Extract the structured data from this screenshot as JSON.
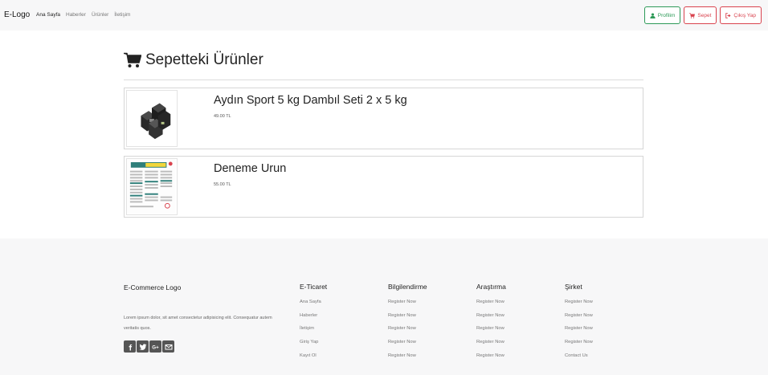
{
  "navbar": {
    "brand": "E-Logo",
    "links": [
      "Ana Sayfa",
      "Haberler",
      "Ürünler",
      "İletişim"
    ],
    "buttons": {
      "profile": "Profilim",
      "cart": "Sepet",
      "logout": "Çıkış Yap"
    }
  },
  "cart": {
    "title": "Sepetteki Ürünler",
    "items": [
      {
        "name": "Aydın Sport 5 kg Dambıl Seti 2 x 5 kg",
        "price": "49.00 TL",
        "image": "dumbbell-product-image"
      },
      {
        "name": "Deneme Urun",
        "price": "55.00 TL",
        "image": "javascript-cheatsheet-image"
      }
    ]
  },
  "footer": {
    "brand": "E-Commerce Logo",
    "about": "Lorem ipsum dolor, sit amet consectetur adipisicing elit. Consequatur autem veritatis quos.",
    "socials": [
      "facebook-icon",
      "twitter-icon",
      "google-plus-icon",
      "mail-icon"
    ],
    "columns": [
      {
        "title": "E-Ticaret",
        "links": [
          "Ana Sayfa",
          "Haberler",
          "İletişim",
          "Giriş Yap",
          "Kayıt Ol"
        ]
      },
      {
        "title": "Bilgilendirme",
        "links": [
          "Register Now",
          "Register Now",
          "Register Now",
          "Register Now",
          "Register Now"
        ]
      },
      {
        "title": "Araştırma",
        "links": [
          "Register Now",
          "Register Now",
          "Register Now",
          "Register Now",
          "Register Now"
        ]
      },
      {
        "title": "Şirket",
        "links": [
          "Register Now",
          "Register Now",
          "Register Now",
          "Register Now",
          "Contact Us"
        ]
      }
    ]
  },
  "colors": {
    "green": "#2e9a58",
    "red": "#d9434e",
    "footer_bg": "#f7f7f8"
  }
}
